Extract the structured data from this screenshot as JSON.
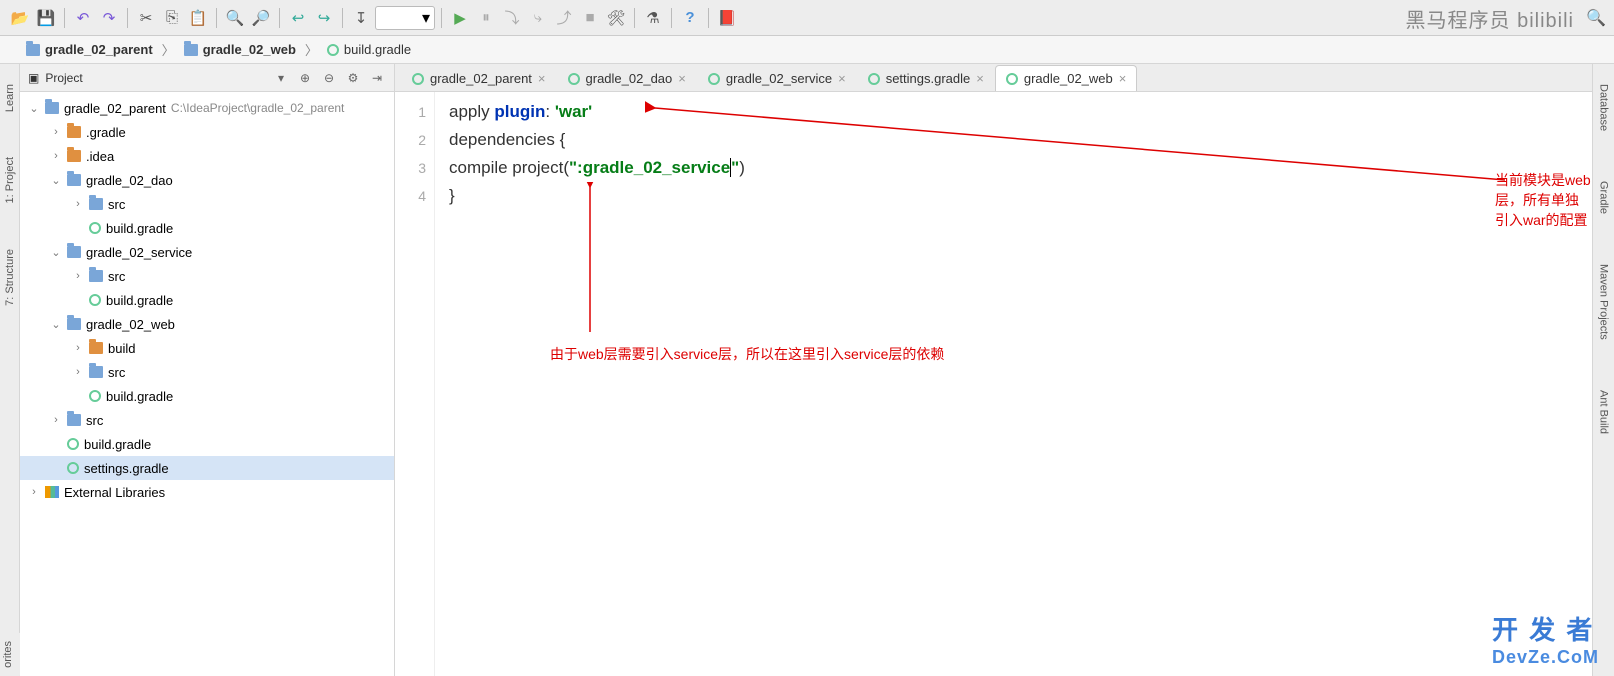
{
  "toolbar_icons": [
    "open",
    "save",
    "sep",
    "undo",
    "redo",
    "sep",
    "cut",
    "copy",
    "paste",
    "sep",
    "zoomin",
    "zoomout",
    "sep",
    "back",
    "forward",
    "sep",
    "sort",
    "combo",
    "sep",
    "run",
    "pause",
    "stepover",
    "stepin",
    "stepout",
    "stop",
    "config",
    "sep",
    "profile",
    "sep",
    "help",
    "sep",
    "exit"
  ],
  "watermark_top": "黑马程序员    bilibili",
  "search_icon": "🔍",
  "breadcrumb": [
    {
      "icon": "folder",
      "text": "gradle_02_parent"
    },
    {
      "icon": "folder",
      "text": "gradle_02_web"
    },
    {
      "icon": "gradle",
      "text": "build.gradle"
    }
  ],
  "left_tools": [
    {
      "icon": "📘",
      "text": "Learn"
    },
    {
      "icon": "📁",
      "text": "1: Project"
    },
    {
      "icon": "⌬",
      "text": "7: Structure"
    }
  ],
  "bottom_tool": "orites",
  "panel_title": "Project",
  "panel_buttons": [
    "▾",
    "⊕",
    "⊖",
    "⚙",
    "⇥"
  ],
  "tree": [
    {
      "lvl": 0,
      "twist": "v",
      "icon": "folder",
      "text": "gradle_02_parent",
      "hint": "C:\\IdeaProject\\gradle_02_parent"
    },
    {
      "lvl": 1,
      "twist": ">",
      "icon": "folder-o",
      "text": ".gradle"
    },
    {
      "lvl": 1,
      "twist": ">",
      "icon": "folder-o",
      "text": ".idea"
    },
    {
      "lvl": 1,
      "twist": "v",
      "icon": "folder",
      "text": "gradle_02_dao"
    },
    {
      "lvl": 2,
      "twist": ">",
      "icon": "folder",
      "text": "src"
    },
    {
      "lvl": 2,
      "twist": "",
      "icon": "gradle",
      "text": "build.gradle"
    },
    {
      "lvl": 1,
      "twist": "v",
      "icon": "folder",
      "text": "gradle_02_service"
    },
    {
      "lvl": 2,
      "twist": ">",
      "icon": "folder",
      "text": "src"
    },
    {
      "lvl": 2,
      "twist": "",
      "icon": "gradle",
      "text": "build.gradle"
    },
    {
      "lvl": 1,
      "twist": "v",
      "icon": "folder",
      "text": "gradle_02_web"
    },
    {
      "lvl": 2,
      "twist": ">",
      "icon": "folder-o",
      "text": "build"
    },
    {
      "lvl": 2,
      "twist": ">",
      "icon": "folder",
      "text": "src"
    },
    {
      "lvl": 2,
      "twist": "",
      "icon": "gradle",
      "text": "build.gradle"
    },
    {
      "lvl": 1,
      "twist": ">",
      "icon": "folder",
      "text": "src"
    },
    {
      "lvl": 1,
      "twist": "",
      "icon": "gradle",
      "text": "build.gradle"
    },
    {
      "lvl": 1,
      "twist": "",
      "icon": "gradle",
      "text": "settings.gradle",
      "selected": true
    },
    {
      "lvl": 0,
      "twist": ">",
      "icon": "lib",
      "text": "External Libraries"
    }
  ],
  "tabs": [
    {
      "text": "gradle_02_parent",
      "icon": "gradle"
    },
    {
      "text": "gradle_02_dao",
      "icon": "gradle"
    },
    {
      "text": "gradle_02_service",
      "icon": "gradle"
    },
    {
      "text": "settings.gradle",
      "icon": "gradle"
    },
    {
      "text": "gradle_02_web",
      "icon": "gradle",
      "active": true
    }
  ],
  "code_lines": [
    "1",
    "2",
    "3",
    "4"
  ],
  "code": {
    "l1_a": "apply ",
    "l1_b": "plugin",
    "l1_c": ": ",
    "l1_d": "'war'",
    "l2": "dependencies {",
    "l3_a": "    compile project(",
    "l3_b": "\":gradle_02_service",
    "l3_c": "\"",
    ")": ")",
    "l4": "}"
  },
  "annot1": "当前模块是web层，所有单独引入war的配置",
  "annot2": "由于web层需要引入service层，所以在这里引入service层的依赖",
  "right_tools": [
    {
      "icon": "🗄",
      "text": "Database"
    },
    {
      "icon": "🐘",
      "text": "Gradle"
    },
    {
      "icon": "m",
      "text": "Maven Projects"
    },
    {
      "icon": "🐜",
      "text": "Ant Build"
    }
  ],
  "watermark_bot1": "开 发 者",
  "watermark_bot2": "DevZe.CoM"
}
